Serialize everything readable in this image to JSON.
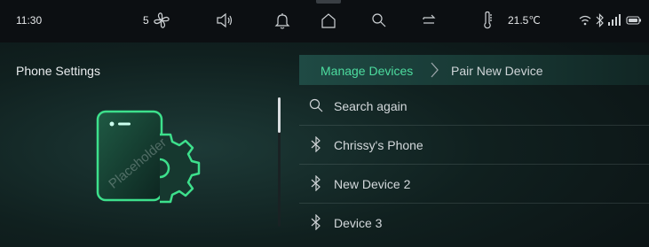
{
  "status_bar": {
    "time": "11:30",
    "fan_level": "5",
    "temperature": "21.5℃"
  },
  "left_panel": {
    "title": "Phone Settings",
    "illustration_watermark": "Placeholder"
  },
  "breadcrumb": {
    "parent": "Manage Devices",
    "current": "Pair New Device"
  },
  "device_list": {
    "search_label": "Search again",
    "devices": [
      {
        "name": "Chrissy's Phone",
        "icon": "bluetooth-icon"
      },
      {
        "name": "New Device 2",
        "icon": "bluetooth-icon"
      },
      {
        "name": "Device 3",
        "icon": "bluetooth-icon"
      }
    ]
  },
  "colors": {
    "accent": "#4ddc9f",
    "status_bg": "#0c0f12"
  }
}
